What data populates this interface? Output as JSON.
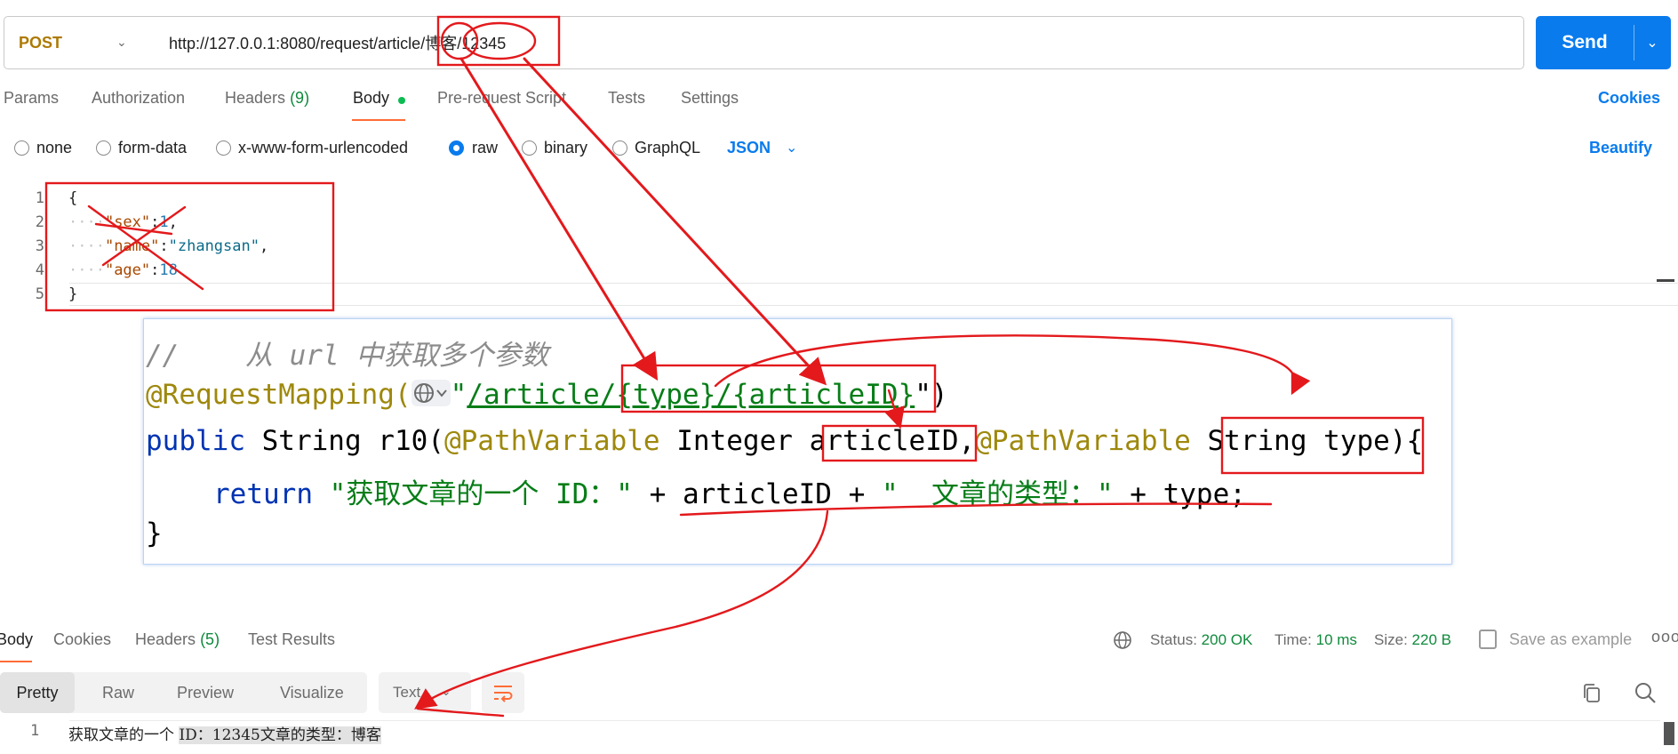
{
  "request": {
    "method": "POST",
    "url": "http://127.0.0.1:8080/request/article/博客/12345",
    "send_label": "Send"
  },
  "request_tabs": [
    {
      "label": "Params"
    },
    {
      "label": "Authorization"
    },
    {
      "label": "Headers",
      "count": "(9)"
    },
    {
      "label": "Body"
    },
    {
      "label": "Pre-request Script"
    },
    {
      "label": "Tests"
    },
    {
      "label": "Settings"
    }
  ],
  "cookies_link": "Cookies",
  "body_types": [
    "none",
    "form-data",
    "x-www-form-urlencoded",
    "raw",
    "binary",
    "GraphQL"
  ],
  "body_type_selected": "raw",
  "body_format": "JSON",
  "beautify": "Beautify",
  "request_body": {
    "line_numbers": [
      "1",
      "2",
      "3",
      "4",
      "5"
    ],
    "open_brace": "{",
    "close_brace": "}",
    "fields": [
      {
        "key": "\"sex\"",
        "value": "1",
        "suffix": ","
      },
      {
        "key": "\"name\"",
        "value": "\"zhangsan\"",
        "suffix": ","
      },
      {
        "key": "\"age\"",
        "value": "18",
        "suffix": ""
      }
    ]
  },
  "code_snippet": {
    "comment": "//    从 url 中获取多个参数",
    "annotation": "@RequestMapping(",
    "path_prefix": "\"",
    "path": "/article/{type}/{articleID}",
    "path_suffix": "\")",
    "signature_kw": "public",
    "signature_a": " String r10(",
    "pv1": "@PathVariable",
    "signature_b": " Integer articleID,",
    "pv2": "@PathVariable",
    "signature_c": " String type){",
    "return_kw": "return",
    "return_str1": "\"获取文章的一个 ID：\"",
    "return_mid": " + articleID + ",
    "return_str2": "\"  文章的类型：\"",
    "return_end": " + type;",
    "close": "}"
  },
  "response_tabs": [
    {
      "label": "Body"
    },
    {
      "label": "Cookies"
    },
    {
      "label": "Headers",
      "count": "(5)"
    },
    {
      "label": "Test Results"
    }
  ],
  "response_meta": {
    "status_label": "Status:",
    "status_value": "200 OK",
    "time_label": "Time:",
    "time_value": "10 ms",
    "size_label": "Size:",
    "size_value": "220 B",
    "save_example": "Save as example",
    "more": "ooo"
  },
  "response_views": [
    "Pretty",
    "Raw",
    "Preview",
    "Visualize"
  ],
  "response_view_selected": "Pretty",
  "response_format": "Text",
  "response_body": {
    "line_number": "1",
    "text_plain": "获取文章的一个 ",
    "text_highlight": "ID：12345文章的类型：博客"
  },
  "colors": {
    "send_blue": "#097bed",
    "accent_orange": "#ff6c37",
    "status_green": "#0f8a3c",
    "annotation_red": "#e3191c"
  }
}
